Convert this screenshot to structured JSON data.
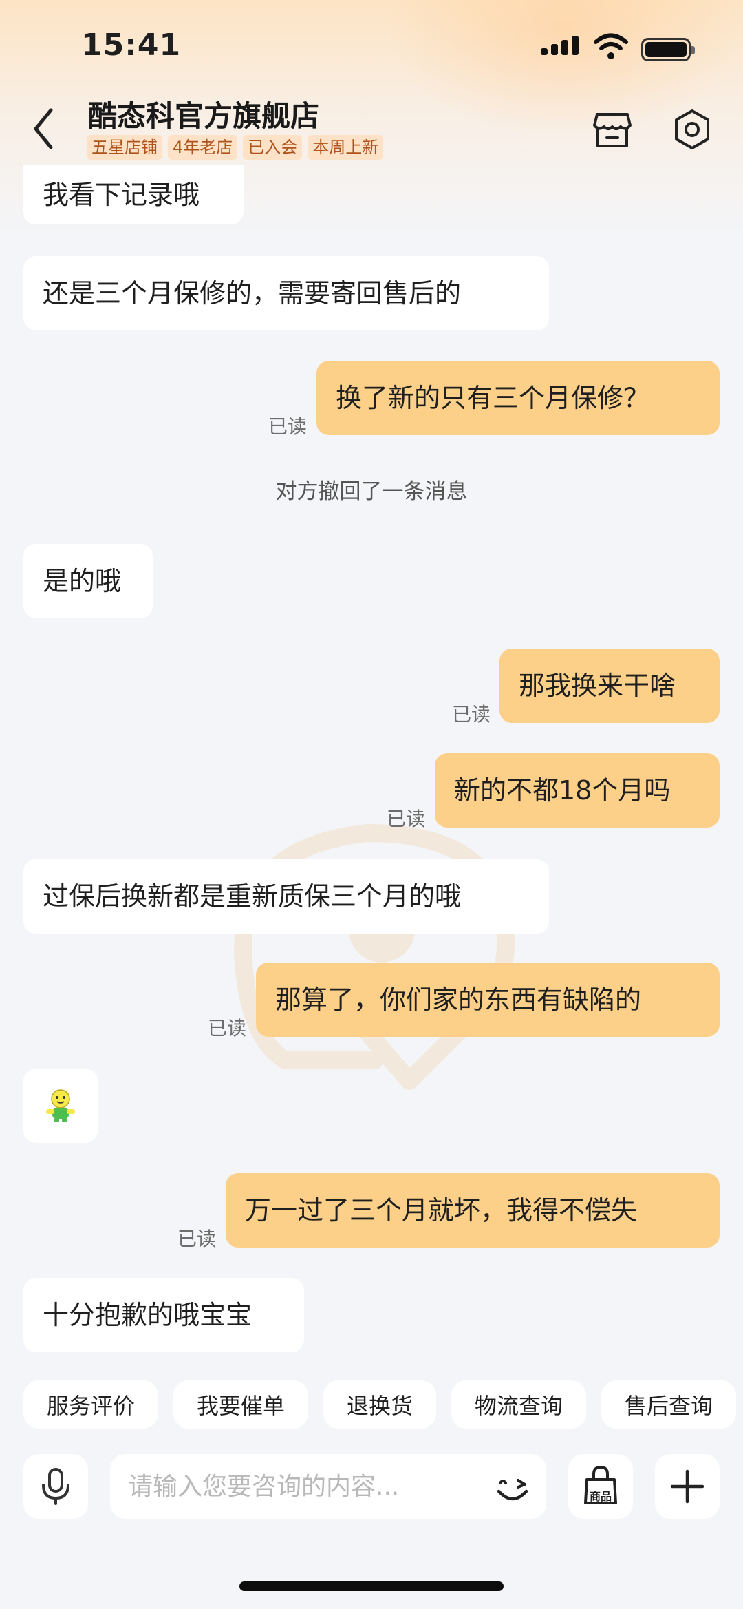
{
  "status_bar": {
    "time": "15:41"
  },
  "header": {
    "shop_name": "酷态科官方旗舰店",
    "tags": [
      "五星店铺",
      "4年老店",
      "已入会",
      "本周上新"
    ]
  },
  "messages": [
    {
      "side": "left",
      "text": "我看下记录哦"
    },
    {
      "side": "left",
      "text": "还是三个月保修的，需要寄回售后的"
    },
    {
      "side": "right",
      "text": "换了新的只有三个月保修？",
      "status": "已读"
    },
    {
      "side": "system",
      "text": "对方撤回了一条消息"
    },
    {
      "side": "left",
      "text": "是的哦"
    },
    {
      "side": "right",
      "text": "那我换来干啥",
      "status": "已读"
    },
    {
      "side": "right",
      "text": "新的不都18个月吗",
      "status": "已读"
    },
    {
      "side": "left",
      "text": "过保后换新都是重新质保三个月的哦"
    },
    {
      "side": "right",
      "text": "那算了，你们家的东西有缺陷的",
      "status": "已读"
    },
    {
      "side": "left",
      "sticker": "smiley-doll-sticker"
    },
    {
      "side": "right",
      "text": "万一过了三个月就坏，我得不偿失",
      "status": "已读"
    },
    {
      "side": "left",
      "text": "十分抱歉的哦宝宝"
    }
  ],
  "quick_actions": [
    "服务评价",
    "我要催单",
    "退换货",
    "物流查询",
    "售后查询"
  ],
  "input": {
    "placeholder": "请输入您要咨询的内容...",
    "value": "",
    "goods_label": "商品"
  },
  "colors": {
    "accent": "#fcd089",
    "tag_bg": "#fde2c8",
    "tag_text": "#b0531a",
    "background": "#f4f5f8"
  }
}
